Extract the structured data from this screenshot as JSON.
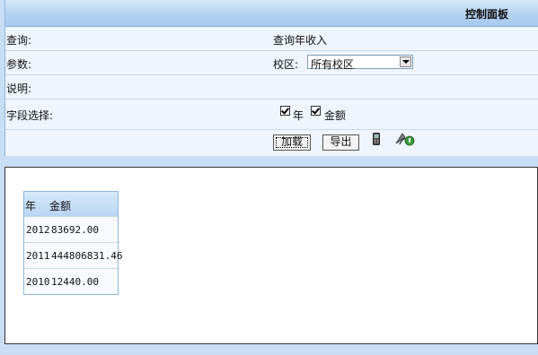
{
  "panel": {
    "title": "控制面板",
    "query_label": "查询:",
    "query_value": "查询年收入",
    "params_label": "参数:",
    "campus_label": "校区:",
    "campus_selected": "所有校区",
    "desc_label": "说明:",
    "fields_label": "字段选择:",
    "field_year": "年",
    "field_amount": "金额",
    "load_button": "加载",
    "export_button": "导出"
  },
  "results": {
    "columns": [
      "年",
      "金额"
    ],
    "rows": [
      {
        "year": "2012",
        "amount": "83692.00"
      },
      {
        "year": "2011",
        "amount": "444806831.46"
      },
      {
        "year": "2010",
        "amount": "12440.00"
      }
    ]
  },
  "icons": [
    "phone-icon",
    "satellite-icon"
  ]
}
